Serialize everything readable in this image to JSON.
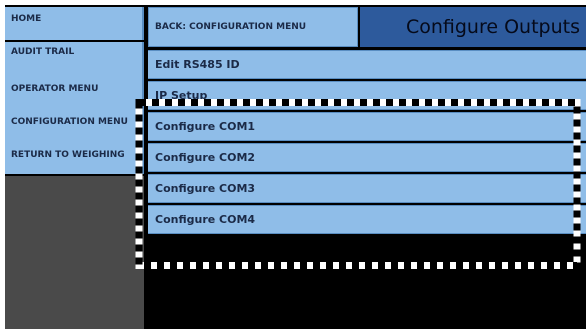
{
  "sidebar": {
    "items": [
      {
        "label": "HOME"
      },
      {
        "label": "AUDIT TRAIL"
      },
      {
        "label": "OPERATOR MENU"
      },
      {
        "label": "CONFIGURATION MENU"
      },
      {
        "label": "RETURN TO WEIGHING"
      }
    ]
  },
  "header": {
    "back_label": "BACK: CONFIGURATION MENU",
    "title": "Configure Outputs"
  },
  "menu": {
    "items": [
      {
        "label": "Edit RS485 ID"
      },
      {
        "label": "IP Setup"
      },
      {
        "label": "Configure COM1"
      },
      {
        "label": "Configure COM2"
      },
      {
        "label": "Configure COM3"
      },
      {
        "label": "Configure COM4"
      }
    ]
  },
  "colors": {
    "button_fill": "#8fbde8",
    "title_fill": "#2d5a9c",
    "background": "#000000"
  }
}
